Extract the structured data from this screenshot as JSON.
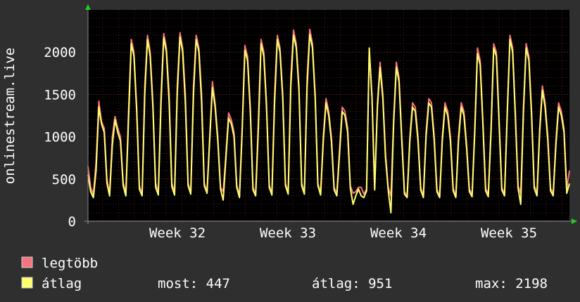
{
  "chart_data": {
    "type": "line",
    "ylabel": "onlinestream.live",
    "ylim": [
      0,
      2500
    ],
    "yticks": [
      0,
      500,
      1000,
      1500,
      2000
    ],
    "xlabels": [
      "Week 32",
      "Week 33",
      "Week 34",
      "Week 35"
    ],
    "grid": true,
    "colors": {
      "background": "#2f2f2f",
      "plot": "#000000",
      "grid": "#5a1a1a",
      "axis": "#8a8a8a",
      "legtobb": "#f7737f",
      "atlag": "#ffff70",
      "arrow": "#22cc22"
    },
    "series": [
      {
        "name": "legtöbb",
        "values": [
          650,
          400,
          320,
          700,
          1420,
          1180,
          1100,
          500,
          320,
          1000,
          1240,
          1100,
          1000,
          460,
          330,
          1300,
          2150,
          2000,
          1350,
          420,
          320,
          1600,
          2200,
          2000,
          1400,
          450,
          330,
          1500,
          2220,
          2050,
          1500,
          450,
          340,
          1600,
          2230,
          2050,
          1500,
          450,
          340,
          1600,
          2200,
          2050,
          1500,
          450,
          350,
          1000,
          1650,
          1400,
          1000,
          400,
          350,
          800,
          1280,
          1200,
          1050,
          430,
          300,
          1100,
          2080,
          1950,
          1350,
          400,
          320,
          1200,
          2150,
          2000,
          1400,
          430,
          330,
          1500,
          2200,
          2050,
          1500,
          450,
          340,
          1700,
          2260,
          2100,
          1600,
          450,
          340,
          1700,
          2270,
          2100,
          1500,
          450,
          340,
          1000,
          1450,
          1300,
          1000,
          400,
          330,
          850,
          1350,
          1300,
          1100,
          420,
          330,
          350,
          400,
          400,
          320,
          380,
          2000,
          1500,
          400,
          1400,
          1880,
          1500,
          800,
          400,
          300,
          1200,
          1880,
          1700,
          1000,
          350,
          300,
          1000,
          1400,
          1350,
          1000,
          400,
          300,
          1050,
          1450,
          1400,
          1000,
          380,
          300,
          1000,
          1400,
          1300,
          1000,
          390,
          300,
          1000,
          1400,
          1300,
          900,
          380,
          320,
          1100,
          2050,
          1900,
          1200,
          390,
          320,
          1100,
          2100,
          2000,
          1200,
          400,
          320,
          1300,
          2200,
          2050,
          1300,
          420,
          330,
          1350,
          2100,
          1950,
          1300,
          420,
          330,
          1100,
          1600,
          1400,
          1000,
          390,
          330,
          950,
          1400,
          1300,
          1100,
          380,
          600
        ]
      },
      {
        "name": "átlag",
        "values": [
          550,
          350,
          280,
          600,
          1350,
          1150,
          1050,
          450,
          300,
          900,
          1200,
          1050,
          950,
          420,
          300,
          1200,
          2100,
          1950,
          1300,
          380,
          300,
          1500,
          2150,
          1950,
          1350,
          400,
          310,
          1400,
          2170,
          2000,
          1400,
          410,
          310,
          1500,
          2180,
          2000,
          1400,
          420,
          320,
          1500,
          2150,
          2000,
          1400,
          420,
          330,
          950,
          1580,
          1350,
          950,
          380,
          250,
          750,
          1220,
          1150,
          1000,
          400,
          280,
          1050,
          2020,
          1900,
          1300,
          370,
          300,
          1100,
          2100,
          1950,
          1350,
          400,
          310,
          1400,
          2150,
          2000,
          1450,
          420,
          320,
          1600,
          2200,
          2050,
          1550,
          420,
          320,
          1600,
          2210,
          2050,
          1450,
          420,
          310,
          950,
          1400,
          1250,
          950,
          370,
          300,
          800,
          1300,
          1250,
          1050,
          390,
          200,
          300,
          380,
          300,
          280,
          360,
          2050,
          1450,
          370,
          1350,
          1820,
          1450,
          750,
          370,
          100,
          1150,
          1820,
          1650,
          950,
          320,
          280,
          950,
          1350,
          1300,
          950,
          370,
          280,
          1000,
          1400,
          1350,
          950,
          350,
          280,
          950,
          1350,
          1250,
          950,
          360,
          280,
          950,
          1350,
          1250,
          850,
          350,
          290,
          1050,
          1980,
          1850,
          1150,
          360,
          290,
          1050,
          2050,
          1950,
          1150,
          370,
          300,
          1250,
          2150,
          2000,
          1250,
          390,
          200,
          1300,
          2050,
          1900,
          1250,
          390,
          300,
          1050,
          1550,
          1350,
          950,
          360,
          300,
          900,
          1350,
          1250,
          1050,
          330,
          447
        ]
      }
    ]
  },
  "legend": [
    {
      "label": "legtöbb",
      "color": "#f7737f"
    },
    {
      "label": "átlag",
      "color": "#ffff70"
    }
  ],
  "stats": {
    "now": "most: 447",
    "avg": "átlag: 951",
    "max": "max: 2198"
  }
}
